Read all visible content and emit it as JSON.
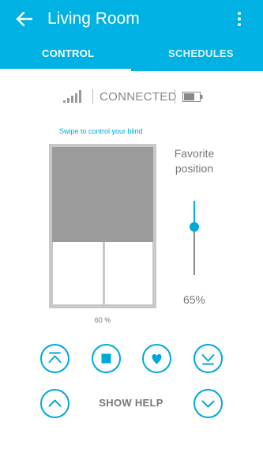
{
  "header": {
    "title": "Living Room",
    "back_icon": "back-arrow-icon",
    "menu_icon": "more-vert-icon",
    "background": "#00b1e3"
  },
  "tabs": [
    {
      "label": "CONTROL",
      "active": true
    },
    {
      "label": "SCHEDULES",
      "active": false
    }
  ],
  "status": {
    "signal_icon": "signal-strength-icon",
    "connection": "CONNECTED",
    "battery_icon": "battery-icon"
  },
  "blind": {
    "hint": "Swipe to control your blind",
    "position_label": "60 %",
    "position_fraction": 0.6
  },
  "favorite": {
    "label": "Favorite position",
    "value_label": "65%",
    "value_fraction": 0.65
  },
  "controls": [
    {
      "name": "open-fully-icon"
    },
    {
      "name": "stop-icon"
    },
    {
      "name": "favorite-heart-icon"
    },
    {
      "name": "close-fully-icon"
    },
    {
      "name": "step-up-icon"
    },
    {
      "name": "step-down-icon"
    }
  ],
  "help": {
    "label": "SHOW HELP"
  },
  "colors": {
    "accent": "#00b1e3",
    "shade": "#9b9b9b",
    "frame": "#c8c8c8"
  }
}
